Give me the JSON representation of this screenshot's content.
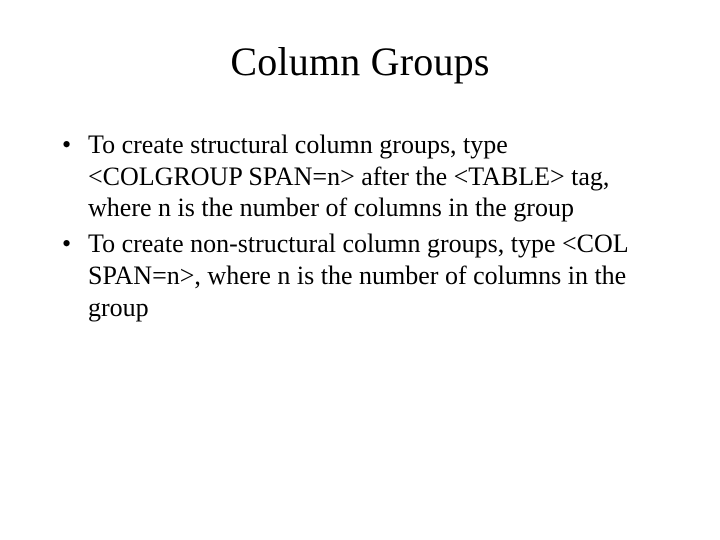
{
  "slide": {
    "title": "Column Groups",
    "bullets": [
      "To create structural column groups, type <COLGROUP SPAN=n> after the <TABLE> tag, where n is the number of columns in the group",
      "To create non-structural column groups, type <COL SPAN=n>, where n is the number of columns in the group"
    ]
  }
}
